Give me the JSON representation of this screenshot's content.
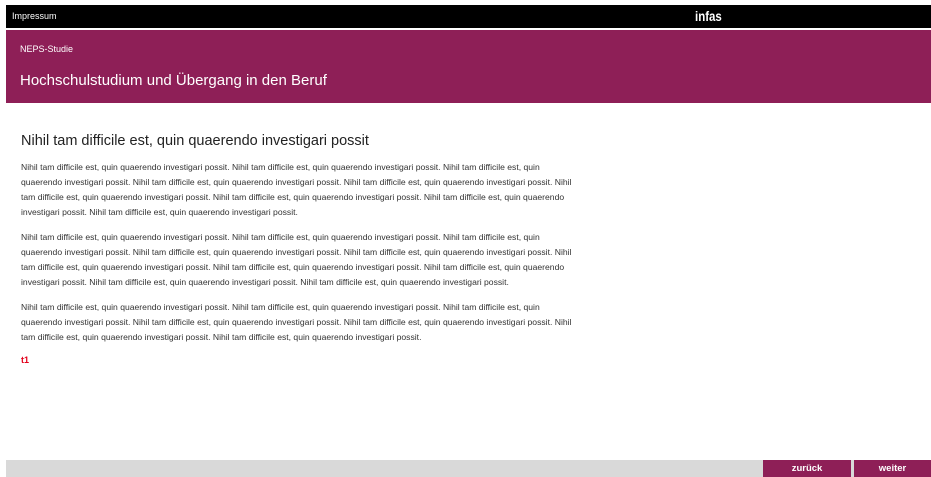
{
  "topbar": {
    "imprint_label": "Impressum",
    "logo_text": "infas"
  },
  "header": {
    "study_label": "NEPS-Studie",
    "title": "Hochschulstudium und Übergang in den Beruf"
  },
  "main": {
    "heading": "Nihil tam difficile est, quin quaerendo investigari possit",
    "paragraphs": [
      "Nihil tam difficile est, quin quaerendo investigari possit. Nihil tam difficile est, quin quaerendo investigari possit. Nihil tam difficile est, quin quaerendo investigari possit. Nihil tam difficile est, quin quaerendo investigari possit. Nihil tam difficile est, quin quaerendo investigari possit. Nihil tam difficile est, quin quaerendo investigari possit. Nihil tam difficile est, quin quaerendo investigari possit. Nihil tam difficile est, quin quaerendo investigari possit. Nihil tam difficile est, quin quaerendo investigari possit.",
      "Nihil tam difficile est, quin quaerendo investigari possit. Nihil tam difficile est, quin quaerendo investigari possit. Nihil tam difficile est, quin quaerendo investigari possit. Nihil tam difficile est, quin quaerendo investigari possit. Nihil tam difficile est, quin quaerendo investigari possit. Nihil tam difficile est, quin quaerendo investigari possit. Nihil tam difficile est, quin quaerendo investigari possit. Nihil tam difficile est, quin quaerendo investigari possit. Nihil tam difficile est, quin quaerendo investigari possit. Nihil tam difficile est, quin quaerendo investigari possit.",
      "Nihil tam difficile est, quin quaerendo investigari possit. Nihil tam difficile est, quin quaerendo investigari possit. Nihil tam difficile est, quin quaerendo investigari possit. Nihil tam difficile est, quin quaerendo investigari possit. Nihil tam difficile est, quin quaerendo investigari possit. Nihil tam difficile est, quin quaerendo investigari possit. Nihil tam difficile est, quin quaerendo investigari possit."
    ],
    "tag": "t1"
  },
  "nav": {
    "back_label": "zurück",
    "next_label": "weiter"
  },
  "colors": {
    "brand": "#8e1f57",
    "topbar": "#000000",
    "footer": "#d9d9d9",
    "tag": "#e3001b"
  }
}
